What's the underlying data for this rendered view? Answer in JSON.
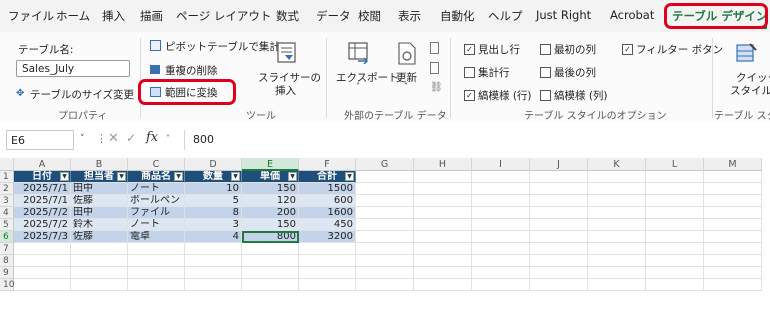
{
  "menu": {
    "tabs": [
      "ファイル",
      "ホーム",
      "挿入",
      "描画",
      "ページ レイアウト",
      "数式",
      "データ",
      "校閲",
      "表示",
      "自動化",
      "ヘルプ",
      "Just Right",
      "Acrobat",
      "テーブル デザイン"
    ]
  },
  "ribbon": {
    "properties": {
      "table_name_label": "テーブル名:",
      "table_name_value": "Sales_July",
      "resize_label": "テーブルのサイズ変更",
      "group_name": "プロパティ"
    },
    "tools": {
      "pivot_label": "ピボットテーブルで集計",
      "remove_dup_label": "重複の削除",
      "convert_range_label": "範囲に変換",
      "slicer_label_1": "スライサーの",
      "slicer_label_2": "挿入",
      "group_name": "ツール"
    },
    "external": {
      "export_label": "エクスポート",
      "refresh_label": "更新",
      "group_name": "外部のテーブル データ"
    },
    "style_options": {
      "header_row": "見出し行",
      "first_column": "最初の列",
      "filter_button": "フィルター ボタン",
      "total_row": "集計行",
      "last_column": "最後の列",
      "banded_rows": "縞模様 (行)",
      "banded_columns": "縞模様 (列)",
      "group_name": "テーブル スタイルのオプション"
    },
    "styles": {
      "quick_label_1": "クイック",
      "quick_label_2": "スタイル ˅",
      "group_name": "テーブル スタ"
    }
  },
  "formula_bar": {
    "name_box": "E6",
    "fx": "fx",
    "value": "800"
  },
  "sheet": {
    "columns": [
      "A",
      "B",
      "C",
      "D",
      "E",
      "F",
      "G",
      "H",
      "I",
      "J",
      "K",
      "L",
      "M"
    ],
    "rows": [
      "1",
      "2",
      "3",
      "4",
      "5",
      "6",
      "7",
      "8",
      "9",
      "10"
    ],
    "table_headers": [
      "日付",
      "担当者",
      "商品名",
      "数量",
      "単価",
      "合計"
    ],
    "table_rows": [
      [
        "2025/7/1",
        "田中",
        "ノート",
        "10",
        "150",
        "1500"
      ],
      [
        "2025/7/1",
        "佐藤",
        "ボールペン",
        "5",
        "120",
        "600"
      ],
      [
        "2025/7/2",
        "田中",
        "ファイル",
        "8",
        "200",
        "1600"
      ],
      [
        "2025/7/2",
        "鈴木",
        "ノート",
        "3",
        "150",
        "450"
      ],
      [
        "2025/7/3",
        "佐藤",
        "電卓",
        "4",
        "800",
        "3200"
      ]
    ]
  }
}
